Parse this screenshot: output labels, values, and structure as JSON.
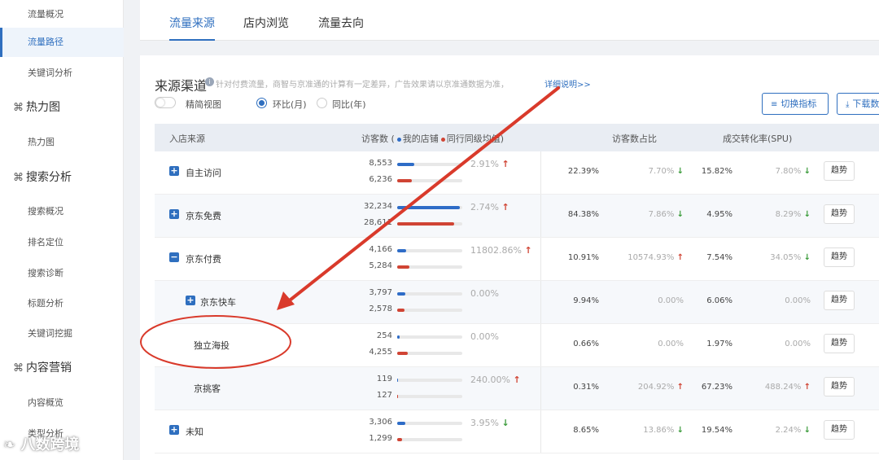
{
  "sidebar": {
    "items": [
      {
        "label": "流量概况",
        "kind": "item"
      },
      {
        "label": "流量路径",
        "kind": "item",
        "active": true
      },
      {
        "label": "关键词分析",
        "kind": "item"
      },
      {
        "label": "热力图",
        "kind": "group",
        "icon": "heatmap-icon"
      },
      {
        "label": "热力图",
        "kind": "item"
      },
      {
        "label": "搜索分析",
        "kind": "group",
        "icon": "search-analysis-icon"
      },
      {
        "label": "搜索概况",
        "kind": "item"
      },
      {
        "label": "排名定位",
        "kind": "item"
      },
      {
        "label": "搜索诊断",
        "kind": "item"
      },
      {
        "label": "标题分析",
        "kind": "item"
      },
      {
        "label": "关键词挖掘",
        "kind": "item"
      },
      {
        "label": "内容营销",
        "kind": "group",
        "icon": "content-marketing-icon"
      },
      {
        "label": "内容概览",
        "kind": "item"
      },
      {
        "label": "类型分析",
        "kind": "item"
      }
    ]
  },
  "tabs": [
    {
      "label": "流量来源",
      "active": true
    },
    {
      "label": "店内浏览"
    },
    {
      "label": "流量去向"
    }
  ],
  "panel": {
    "title": "来源渠道",
    "note": "针对付费流量，商智与京准通的计算有一定差异，广告效果请以京准通数据为准，",
    "note_link": "详细说明>>",
    "toggle_label": "精简视图",
    "radio_mom": "环比(月)",
    "radio_yoy": "同比(年)",
    "switch_button": "切换指标",
    "download_button": "下载数"
  },
  "table": {
    "headers": {
      "source": "入店来源",
      "visitors_prefix": "访客数 (",
      "my_store": "我的店铺",
      "peer_avg": "同行同级均值",
      "visitors_suffix": ")",
      "share": "访客数占比",
      "conversion": "成交转化率(SPU)"
    },
    "rows": [
      {
        "name": "自主访问",
        "icon": "plus",
        "mine": "8,553",
        "peer": "6,236",
        "mine_frac": 0.26,
        "peer_frac": 0.22,
        "change": "2.91%",
        "change_dir": "up",
        "share": "22.39%",
        "share_change": "7.70%",
        "share_dir": "down",
        "conv": "15.82%",
        "conv_change": "7.80%",
        "conv_dir": "down",
        "trend": "趋势"
      },
      {
        "name": "京东免费",
        "icon": "plus",
        "mine": "32,234",
        "peer": "28,611",
        "mine_frac": 0.96,
        "peer_frac": 0.87,
        "change": "2.74%",
        "change_dir": "up",
        "share": "84.38%",
        "share_change": "7.86%",
        "share_dir": "down",
        "conv": "4.95%",
        "conv_change": "8.29%",
        "conv_dir": "down",
        "trend": "趋势"
      },
      {
        "name": "京东付费",
        "icon": "minus",
        "mine": "4,166",
        "peer": "5,284",
        "mine_frac": 0.14,
        "peer_frac": 0.19,
        "change": "11802.86%",
        "change_dir": "up",
        "share": "10.91%",
        "share_change": "10574.93%",
        "share_dir": "up",
        "conv": "7.54%",
        "conv_change": "34.05%",
        "conv_dir": "down",
        "trend": "趋势"
      },
      {
        "name": "京东快车",
        "icon": "plus",
        "mine": "3,797",
        "peer": "2,578",
        "mine_frac": 0.13,
        "peer_frac": 0.11,
        "change": "0.00%",
        "change_dir": "",
        "share": "9.94%",
        "share_change": "0.00%",
        "share_dir": "",
        "conv": "6.06%",
        "conv_change": "0.00%",
        "conv_dir": "",
        "trend": "趋势"
      },
      {
        "name": "独立海投",
        "icon": "",
        "mine": "254",
        "peer": "4,255",
        "mine_frac": 0.04,
        "peer_frac": 0.16,
        "change": "0.00%",
        "change_dir": "",
        "share": "0.66%",
        "share_change": "0.00%",
        "share_dir": "",
        "conv": "1.97%",
        "conv_change": "0.00%",
        "conv_dir": "",
        "trend": "趋势"
      },
      {
        "name": "京挑客",
        "icon": "",
        "mine": "119",
        "peer": "127",
        "mine_frac": 0.01,
        "peer_frac": 0.01,
        "change": "240.00%",
        "change_dir": "up",
        "share": "0.31%",
        "share_change": "204.92%",
        "share_dir": "up",
        "conv": "67.23%",
        "conv_change": "488.24%",
        "conv_dir": "up",
        "trend": "趋势"
      },
      {
        "name": "未知",
        "icon": "plus",
        "mine": "3,306",
        "peer": "1,299",
        "mine_frac": 0.12,
        "peer_frac": 0.07,
        "change": "3.95%",
        "change_dir": "down",
        "share": "8.65%",
        "share_change": "13.86%",
        "share_dir": "down",
        "conv": "19.54%",
        "conv_change": "2.24%",
        "conv_dir": "down",
        "trend": "趋势"
      }
    ]
  },
  "annotation": {
    "color": "#d93a2b"
  },
  "watermark": "八数跨境",
  "colors": {
    "accent": "#2f6fbf",
    "mine_bar": "#2e6cc7",
    "peer_bar": "#d04434",
    "up": "#d04434",
    "down": "#3a9b3a"
  }
}
